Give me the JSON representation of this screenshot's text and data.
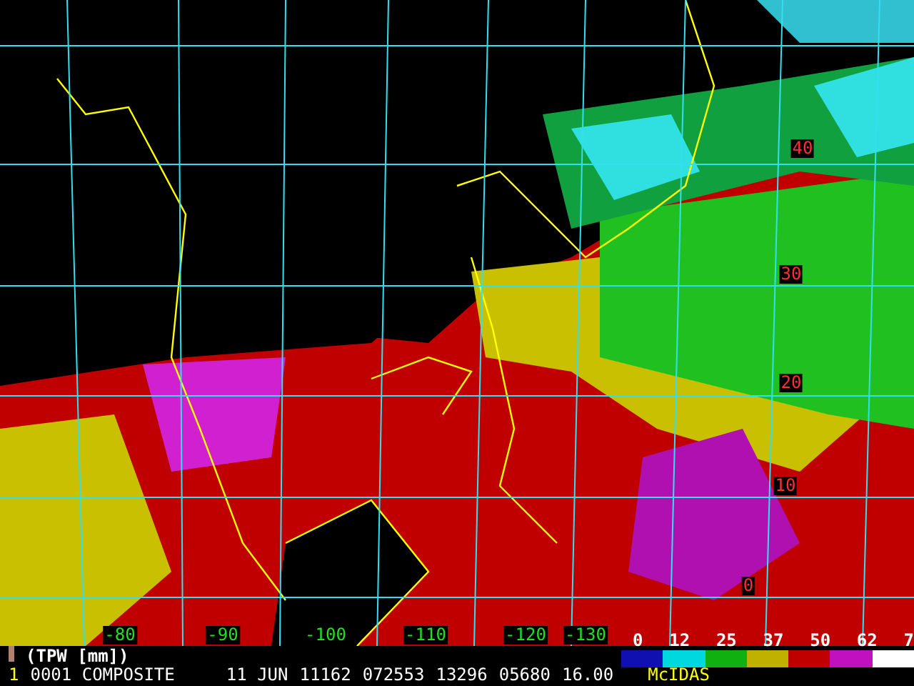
{
  "map": {
    "lat_labels": [
      "40",
      "30",
      "20",
      "10",
      "0"
    ],
    "lon_labels": [
      "-80",
      "-90",
      "-100",
      "-110",
      "-120",
      "-130"
    ]
  },
  "legend": {
    "ticks": [
      "0",
      "12",
      "25",
      "37",
      "50",
      "62",
      "7"
    ],
    "segments": [
      {
        "color": "#1010b0"
      },
      {
        "color": "#00d8e0"
      },
      {
        "color": "#10b010"
      },
      {
        "color": "#c0b000"
      },
      {
        "color": "#c00000"
      },
      {
        "color": "#c010c0"
      },
      {
        "color": "#ffffff"
      }
    ]
  },
  "status": {
    "product": "(TPW [mm])",
    "frame": "1",
    "name": "0001 COMPOSITE",
    "fields": [
      "11 JUN",
      "11162",
      "072553",
      "13296",
      "05680",
      "16.00"
    ],
    "brand": "McIDAS"
  }
}
